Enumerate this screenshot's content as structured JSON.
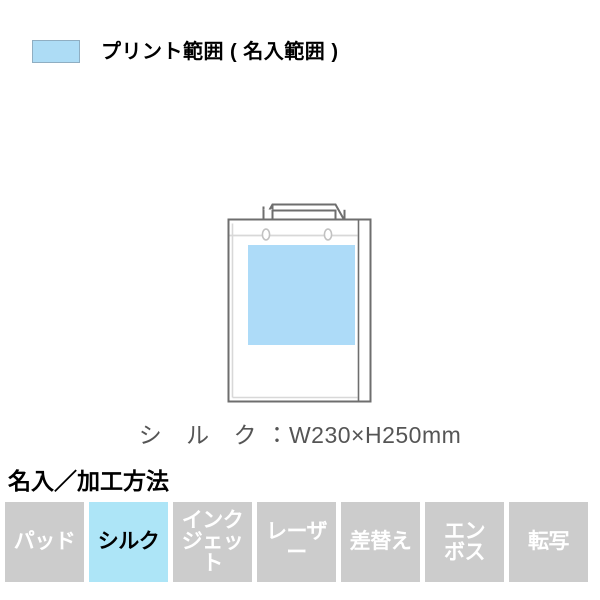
{
  "legend": {
    "swatch_color": "#ADDCF5",
    "swatch_border_color": "#8FAEC2",
    "label": "プリント範囲 ( 名入範囲 )"
  },
  "illustration": {
    "product_type": "paper-bag",
    "outline_color": "#6E6E6E",
    "fold_line_color": "#D8D8D8",
    "print_area_color": "#ADDBF8",
    "eyelet_color": "#C9C9C9"
  },
  "caption": {
    "method": "シ ル ク",
    "separator": "：",
    "size": "W230×H250mm",
    "full": "シ ル ク：W230×H250mm"
  },
  "section": {
    "heading": "名入／加工方法"
  },
  "methods": {
    "active_color": "#ADE5F7",
    "inactive_color": "#CCCCCC",
    "items": [
      {
        "label": "パッド",
        "active": false
      },
      {
        "label": "シルク",
        "active": true
      },
      {
        "label": "インク\nジェット",
        "active": false
      },
      {
        "label": "レーザー",
        "active": false
      },
      {
        "label": "差替え",
        "active": false
      },
      {
        "label": "エン\nボス",
        "active": false
      },
      {
        "label": "転写",
        "active": false
      }
    ]
  }
}
